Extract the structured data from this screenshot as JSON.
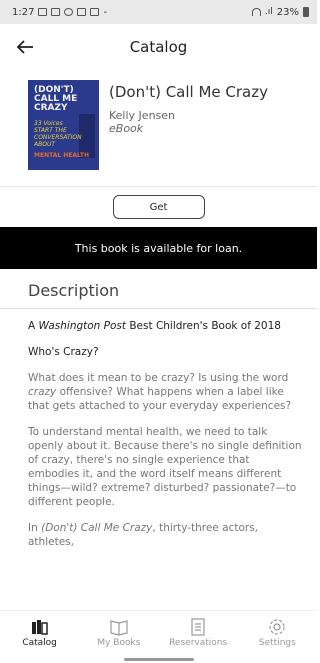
{
  "status": {
    "time": "1:27",
    "battery": "23%"
  },
  "header": {
    "title": "Catalog"
  },
  "book": {
    "title": "(Don't) Call Me Crazy",
    "author": "Kelly Jensen",
    "format": "eBook",
    "cover": {
      "line1": "(DON'T)",
      "line2": "CALL ME",
      "line3": "CRAZY",
      "subtitle1": "33 Voices",
      "subtitle2": "START THE",
      "subtitle3": "CONVERSATION",
      "subtitle4": "ABOUT",
      "subtitle5": "MENTAL HEALTH"
    }
  },
  "actions": {
    "get_label": "Get"
  },
  "loan_notice": "This book is available for loan.",
  "description": {
    "heading": "Description",
    "p1_pre": "A ",
    "p1_italic": "Washington Post",
    "p1_post": " Best Children's Book of 2018",
    "p2": "Who's Crazy?",
    "p3_a": "What does it mean to be crazy? Is using the word ",
    "p3_italic": "crazy",
    "p3_b": " offensive? What happens when a label like that gets attached to your everyday experiences?",
    "p4": "To understand mental health, we need to talk openly about it. Because there's no single definition of crazy, there's no single experience that embodies it, and the word itself means different things—wild? extreme? disturbed? passionate?—to different people.",
    "p5_a": "In ",
    "p5_italic": "(Don't) Call Me Crazy",
    "p5_b": ", thirty-three actors, athletes,"
  },
  "nav": [
    {
      "label": "Catalog",
      "icon": "catalog-icon",
      "active": true
    },
    {
      "label": "My Books",
      "icon": "book-icon",
      "active": false
    },
    {
      "label": "Reservations",
      "icon": "reservations-icon",
      "active": false
    },
    {
      "label": "Settings",
      "icon": "gear-icon",
      "active": false
    }
  ],
  "colors": {
    "loan_bg": "#000000",
    "cover_bg": "#2b3a8c"
  }
}
